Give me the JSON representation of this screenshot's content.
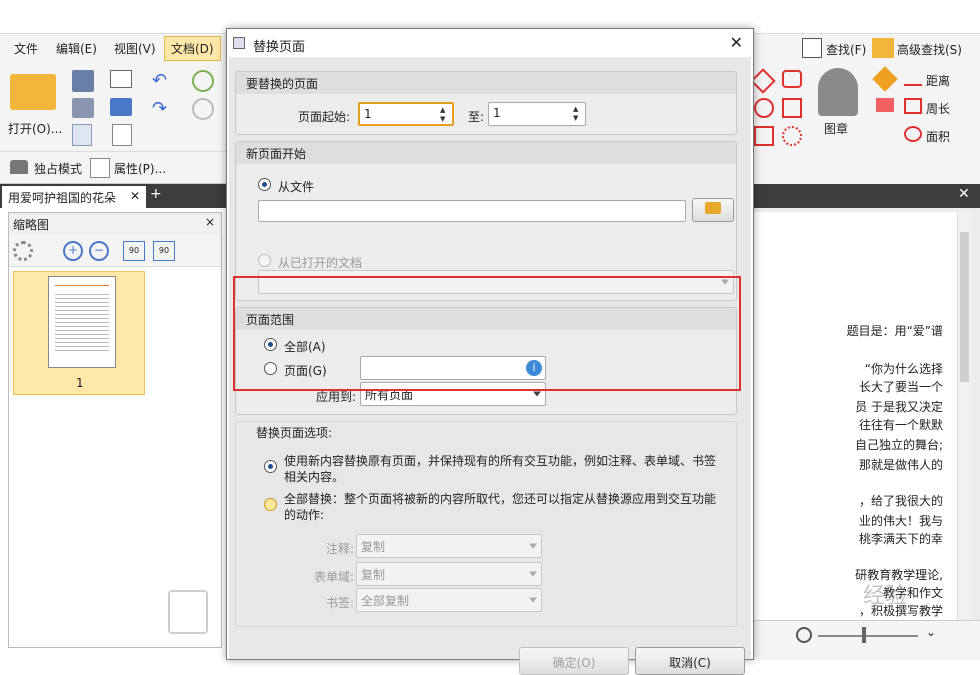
{
  "app": {
    "menus": [
      "文件",
      "编辑(E)",
      "视图(V)",
      "文档(D)"
    ],
    "open_label": "打开(O)...",
    "exclusive_mode": "独占模式",
    "properties": "属性(P)...",
    "find": "查找(F)",
    "advanced_find": "高级查找(S)",
    "distance": "距离",
    "perimeter": "周长",
    "area": "面积",
    "stamp": "图章",
    "doc_tab": "用爱呵护祖国的花朵",
    "thumbs_title": "缩略图",
    "page_number": "1",
    "rotate_90_a": "90",
    "rotate_90_b": "90",
    "doc_lines": [
      "题目是：用“爱”谱",
      "“你为什么选择",
      "长大了要当一个",
      "员 于是我又决定",
      "往往有一个默默",
      "自己独立的舞台;",
      "那就是做伟人的",
      "，给了我很大的",
      "业的伟大！我与",
      "桃李满天下的幸",
      "研教育教学理论,",
      "教学和作文",
      "，积极撰写教学"
    ],
    "watermark": "经验"
  },
  "dialog": {
    "title": "替换页面",
    "replace_section": "要替换的页面",
    "page_start_label": "页面起始:",
    "page_start_value": "1",
    "to_label": "至:",
    "to_value": "1",
    "new_page_section": "新页面开始",
    "from_file": "从文件",
    "from_open_doc": "从已打开的文档",
    "range_section": "页面范围",
    "all_label": "全部(A)",
    "pages_label": "页面(G)",
    "apply_to_label": "应用到:",
    "apply_to_value": "所有页面",
    "options_section": "替换页面选项:",
    "option1": "使用新内容替换原有页面，并保持现有的所有交互功能，例如注释、表单域、书签相关内容。",
    "option1_line1": "使用新内容替换原有页面，并保持现有的所有交互功能，例如注释、表单域、书签",
    "option1_line2": "相关内容。",
    "option2_line1": "全部替换：整个页面将被新的内容所取代，您还可以指定从替换源应用到交互功能",
    "option2_line2": "的动作:",
    "annot_label": "注释:",
    "annot_value": "复制",
    "form_label": "表单域:",
    "form_value": "复制",
    "bookmark_label": "书签:",
    "bookmark_value": "全部复制",
    "ok": "确定(O)",
    "cancel": "取消(C)"
  },
  "colors": {
    "highlight_box": "#e03030",
    "accent_orange": "#f0a020",
    "selection": "#fde8a8"
  }
}
